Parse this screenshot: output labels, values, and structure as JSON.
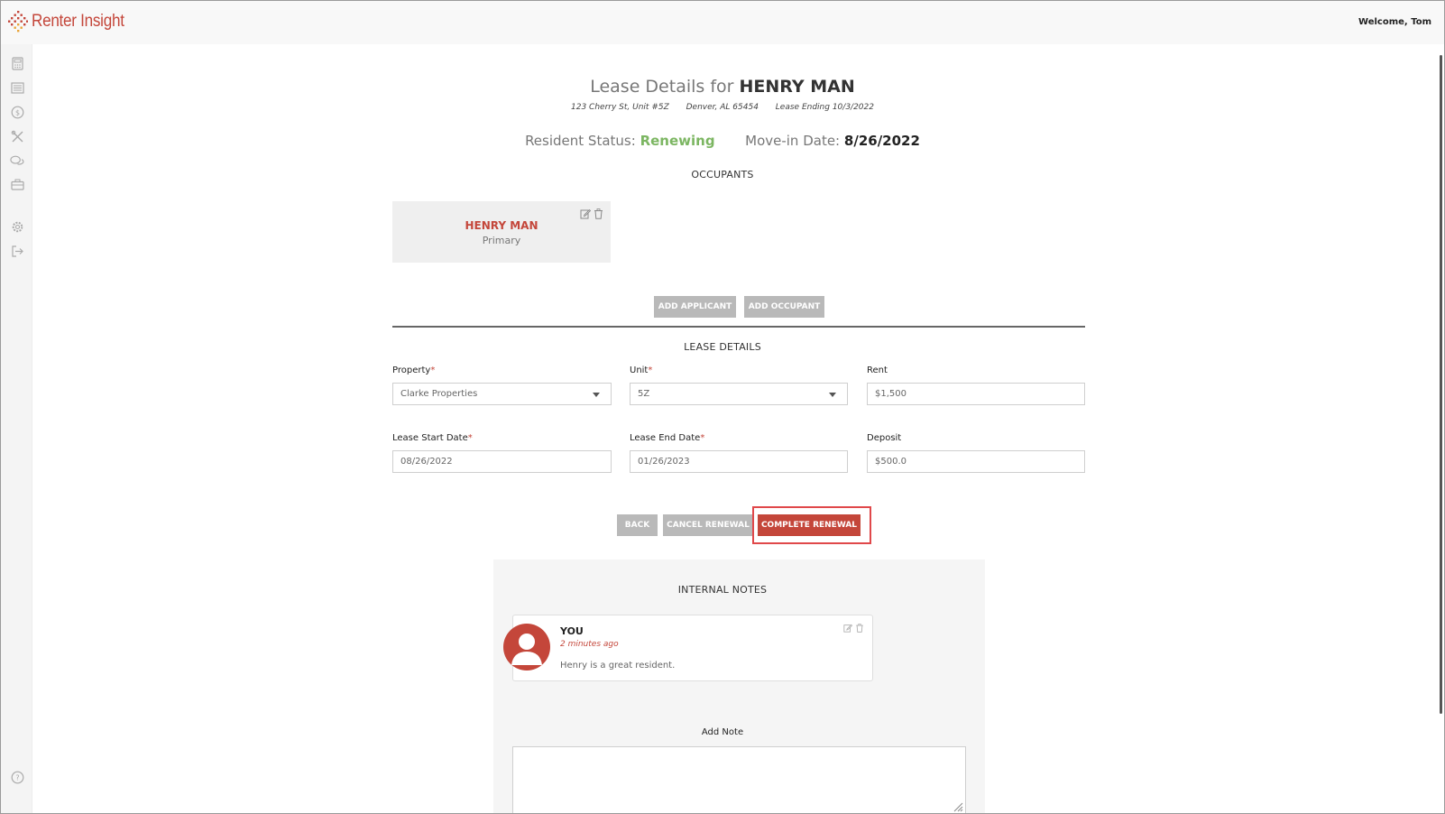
{
  "header": {
    "brand": "Renter Insight",
    "welcome": "Welcome, Tom"
  },
  "sidebar": {
    "items": [
      {
        "icon": "calculator-icon"
      },
      {
        "icon": "list-icon"
      },
      {
        "icon": "dollar-icon"
      },
      {
        "icon": "tools-icon"
      },
      {
        "icon": "chat-icon"
      },
      {
        "icon": "briefcase-icon"
      },
      {
        "icon": "gear-icon"
      },
      {
        "icon": "logout-icon"
      },
      {
        "icon": "help-icon"
      }
    ]
  },
  "page": {
    "title_prefix": "Lease Details for",
    "title_name": "HENRY MAN",
    "address": "123 Cherry St, Unit #5Z",
    "city": "Denver, AL 65454",
    "lease_ending": "Lease Ending 10/3/2022",
    "status_label": "Resident Status:",
    "status_value": "Renewing",
    "movein_label": "Move-in Date:",
    "movein_value": "8/26/2022"
  },
  "occupants": {
    "title": "OCCUPANTS",
    "items": [
      {
        "name": "HENRY MAN",
        "role": "Primary"
      }
    ],
    "add_applicant": "ADD APPLICANT",
    "add_occupant": "ADD OCCUPANT"
  },
  "lease_details": {
    "title": "LEASE DETAILS",
    "property_label": "Property",
    "property_value": "Clarke Properties",
    "unit_label": "Unit",
    "unit_value": "5Z",
    "rent_label": "Rent",
    "rent_value": "$1,500",
    "start_label": "Lease Start Date",
    "start_value": "08/26/2022",
    "end_label": "Lease End Date",
    "end_value": "01/26/2023",
    "deposit_label": "Deposit",
    "deposit_value": "$500.0",
    "required_mark": "*"
  },
  "actions": {
    "back": "BACK",
    "cancel": "CANCEL RENEWAL",
    "complete": "COMPLETE RENEWAL"
  },
  "notes": {
    "title": "INTERNAL NOTES",
    "items": [
      {
        "author": "YOU",
        "time": "2 minutes ago",
        "text": "Henry is a great resident."
      }
    ],
    "add_label": "Add Note"
  },
  "colors": {
    "brand": "#c4463a",
    "status": "#7cb662",
    "button_grey": "#b9b9b9",
    "highlight": "#e0484a"
  }
}
